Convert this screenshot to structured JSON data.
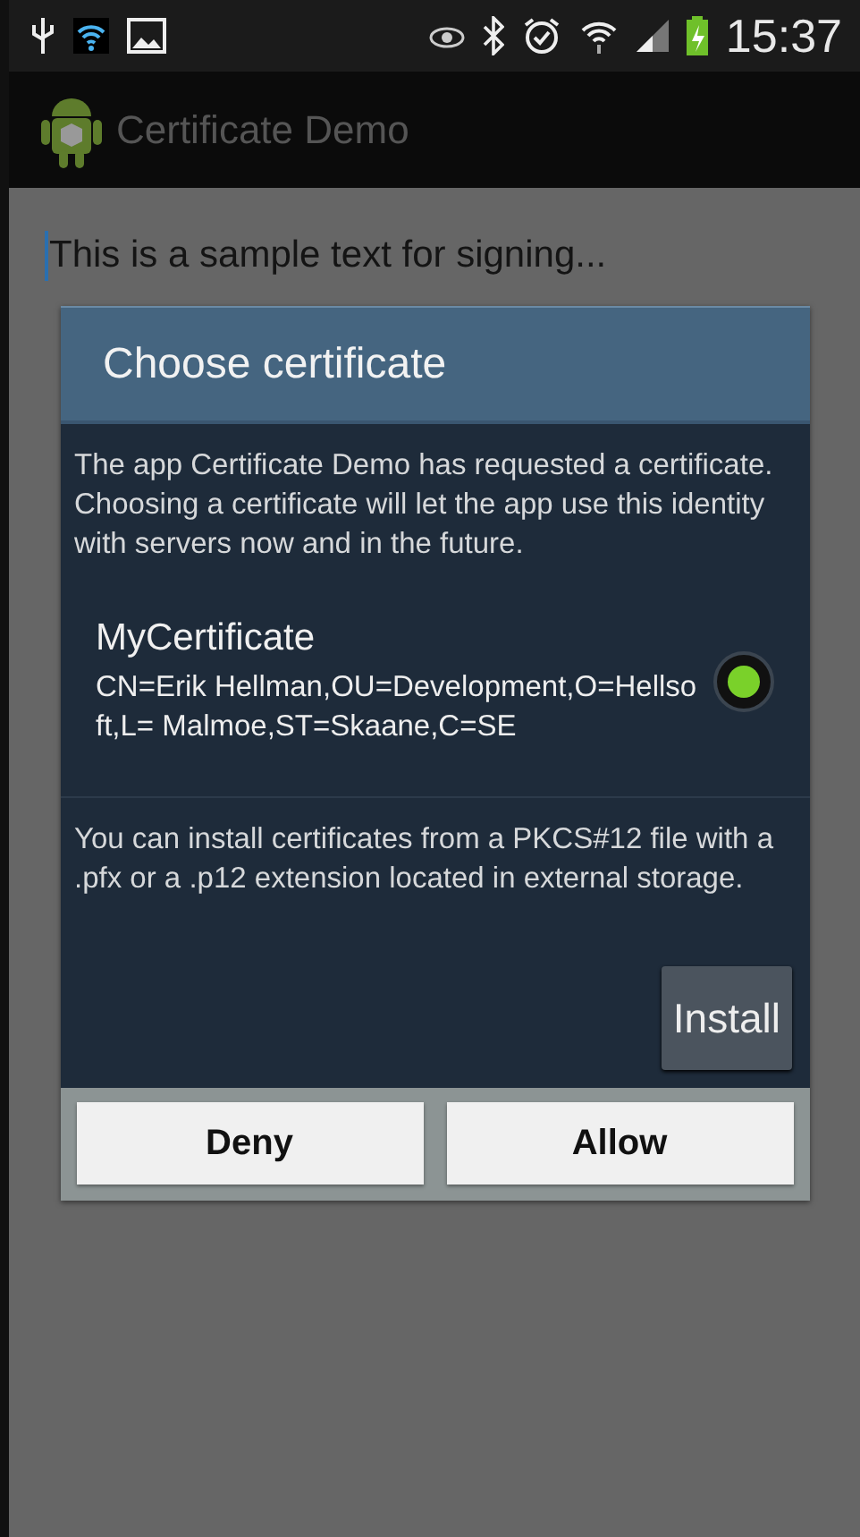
{
  "status_bar": {
    "time": "15:37"
  },
  "action_bar": {
    "title": "Certificate Demo"
  },
  "text_field": {
    "value": "This is a sample text for signing..."
  },
  "dialog": {
    "title": "Choose certificate",
    "message": "The app Certificate Demo has requested a certificate. Choosing a certificate will let the app use this identity with servers now and in the future.",
    "certificates": [
      {
        "name": "MyCertificate",
        "subject": "CN=Erik Hellman,OU=Development,O=Hellsoft,L= Malmoe,ST=Skaane,C=SE",
        "selected": true
      }
    ],
    "install_note": "You can install certificates from a PKCS#12 file with a .pfx or a .p12 extension located in external storage.",
    "install_button": "Install",
    "buttons": [
      "Deny",
      "Allow"
    ]
  }
}
